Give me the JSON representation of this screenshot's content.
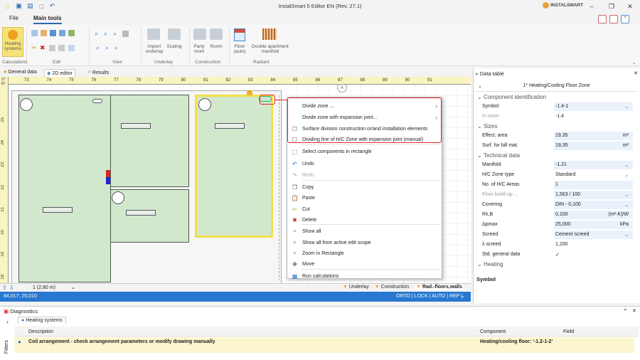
{
  "window": {
    "title": "InstalSmart 5 Editor EN (Rev. 27.1)",
    "brand": "INSTALSMART"
  },
  "menu": {
    "file": "File",
    "main_tools": "Main tools"
  },
  "ribbon": {
    "heating_systems": "Heating systems",
    "import_underlay": "Import underlay",
    "scaling": "Scaling",
    "party_room": "Party room",
    "room": "Room",
    "floor_auto": "Floor (auto)",
    "double_manifold": "Double apartment manifold",
    "groups": [
      "Calculations",
      "Edit",
      "View",
      "Underlay",
      "Construction",
      "Radiant"
    ]
  },
  "doc_tabs": [
    "General data",
    "2D editor",
    "Results"
  ],
  "ruler": {
    "h": [
      "73",
      "74",
      "75",
      "76",
      "77",
      "78",
      "79",
      "80",
      "81",
      "82",
      "83",
      "84",
      "85",
      "86",
      "87",
      "88",
      "89",
      "90",
      "91"
    ],
    "v": [
      "25",
      "24",
      "23",
      "22",
      "21",
      "20",
      "19",
      "18"
    ],
    "corner_top": "27",
    "corner_left": "87"
  },
  "canvas": {
    "circle_label": "A"
  },
  "status": {
    "level": "1 (2,80 m)",
    "layers": [
      "Underlay",
      "Construction",
      "Rad.-floors,walls"
    ],
    "coords": "84,017; 25,010",
    "modes": "ORTO | LOCK | AUTO | REP |"
  },
  "context_menu": {
    "items": [
      {
        "label": "Divide zone ...",
        "submenu": true,
        "icon": "none"
      },
      {
        "label": "Divide zone with expansion joint...",
        "submenu": true,
        "icon": "none"
      },
      {
        "label": "Surface division construction or/and installation elements",
        "icon": "checkbox"
      },
      {
        "label": "Dividing line of H/C Zone with expansion joint (manual)",
        "icon": "checkbox"
      },
      {
        "label": "Select components in rectangle",
        "icon": "select"
      },
      {
        "label": "Undo",
        "icon": "undo"
      },
      {
        "label": "Redo",
        "icon": "redo",
        "disabled": true
      },
      {
        "label": "Copy",
        "icon": "copy"
      },
      {
        "label": "Paste",
        "icon": "paste"
      },
      {
        "label": "Cut",
        "icon": "cut"
      },
      {
        "label": "Delete",
        "icon": "delete"
      },
      {
        "label": "Show all",
        "icon": "zoom"
      },
      {
        "label": "Show all from active edit scope",
        "icon": "zoom"
      },
      {
        "label": "Zoom in Rectangle",
        "icon": "zoom"
      },
      {
        "label": "Move",
        "icon": "move"
      },
      {
        "label": "Run calculations",
        "icon": "calc"
      }
    ]
  },
  "data_table": {
    "header": "Data table",
    "subtitle": "1* Heating/Cooling Floor Zone",
    "sections": {
      "component": "Component identification",
      "sizes": "Sizes",
      "technical": "Technical data",
      "heating": "Heating"
    },
    "rows": {
      "symbol": {
        "k": "Symbol",
        "v": "-1.4-1"
      },
      "in_room": {
        "k": "In room",
        "v": "-1.4"
      },
      "effect_area": {
        "k": "Effect. area",
        "v": "19,35",
        "u": "m²"
      },
      "surf_bill": {
        "k": "Surf. for bill mat.",
        "v": "19,35",
        "u": "m²"
      },
      "manifold": {
        "k": "Manifold",
        "v": "-1.21"
      },
      "zone_type": {
        "k": "H/C Zone type",
        "v": "Standard"
      },
      "areas": {
        "k": "No. of H/C Areas",
        "v": "1"
      },
      "buildup": {
        "k": "Floor build-up ...",
        "v": "1,563 / 100"
      },
      "covering": {
        "k": "Covering",
        "v": "DIN - 0,100"
      },
      "rlb": {
        "k": "Rλ,B",
        "v": "0,100",
        "u": "(m²·K)/W"
      },
      "dpmax": {
        "k": "Δpmax",
        "v": "25,000",
        "u": "kPa"
      },
      "screed": {
        "k": "Screed",
        "v": "Cement screed"
      },
      "lscreed": {
        "k": "λ screed",
        "v": "1,200"
      },
      "std": {
        "k": "Std. general data",
        "v": "✓"
      }
    },
    "footer": "Symbol"
  },
  "diagnostics": {
    "title": "Diagnostics",
    "tab": "Heating systems",
    "cols": [
      "Description",
      "Component",
      "Field"
    ],
    "row": {
      "desc": "Coil arrangement - check arrangement parameters or modify drawing manually",
      "component": "Heating/cooling floor: '-1.2-1-2'"
    },
    "side": "Filters"
  },
  "colors": {
    "accent": "#2878d0",
    "highlight": "#e0242b",
    "room": "#d2e8cd",
    "selected": "#f0e04a"
  }
}
